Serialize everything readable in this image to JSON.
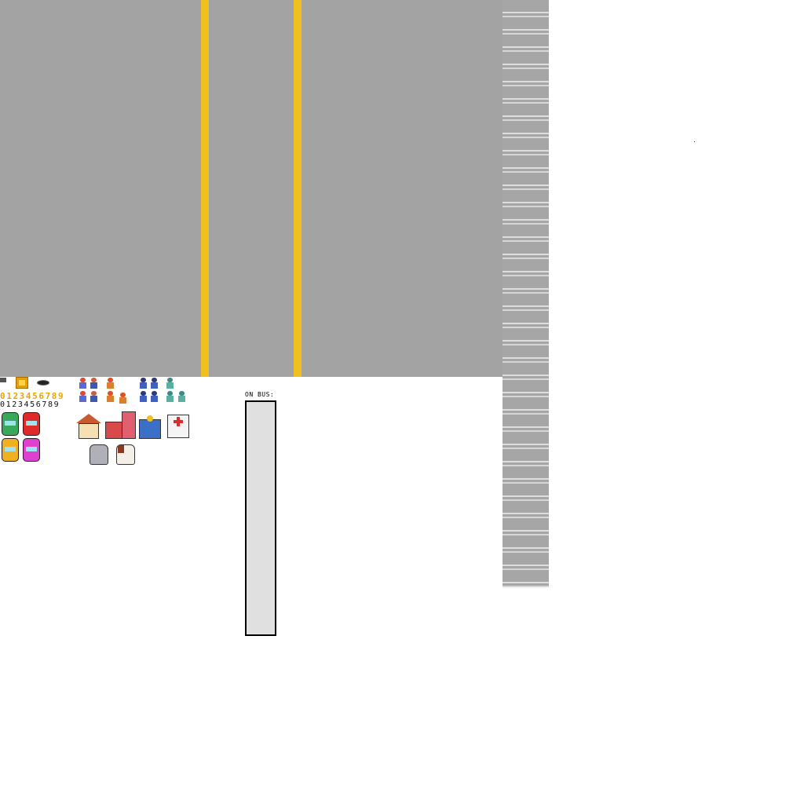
{
  "colors": {
    "road": "#a3a3a3",
    "lane_line": "#f0c020",
    "panel_fill": "#e0e0e0",
    "digits_gold": "#e8a800"
  },
  "sprites": {
    "coin_icon": "coin-icon",
    "pothole_icon": "pothole-icon",
    "digits_gold": "0123456789",
    "digits_black": "0123456789",
    "buses": [
      "green-bus-icon",
      "red-bus-icon",
      "yellow-bus-icon",
      "magenta-bus-icon"
    ],
    "buildings": [
      "house-icon",
      "fire-station-icon",
      "police-station-icon",
      "hospital-icon"
    ],
    "animals": [
      "cat-icon",
      "dog-icon"
    ]
  },
  "hud": {
    "on_bus_label": "ON BUS:"
  }
}
